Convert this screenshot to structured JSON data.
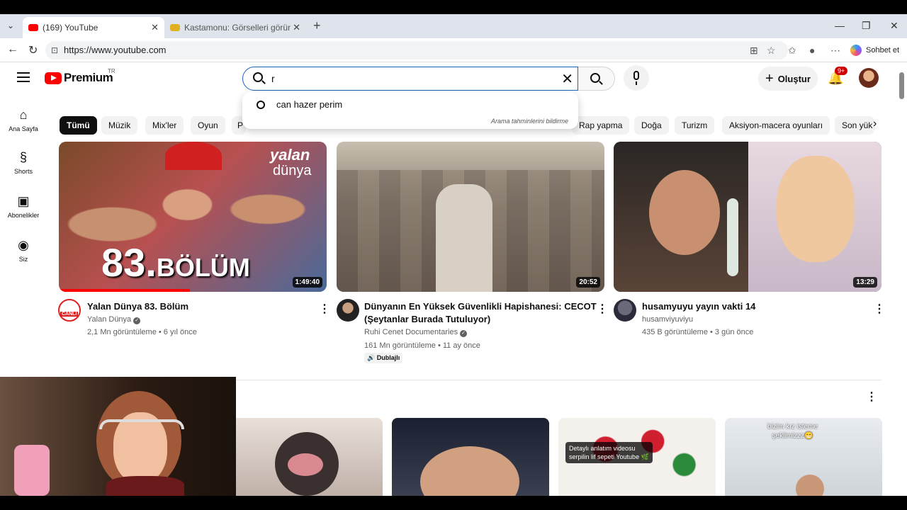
{
  "browser": {
    "tabs": [
      {
        "label": "(169) YouTube",
        "active": true
      },
      {
        "label": "Kastamonu: Görselleri görüntüley",
        "active": false
      }
    ],
    "url": "https://www.youtube.com",
    "copilot_label": "Sohbet et"
  },
  "yt": {
    "logo_text": "Premium",
    "country": "TR",
    "search_value": "r",
    "suggestion": "can hazer perim",
    "report_text": "Arama tahminlerini bildirme",
    "create_label": "Oluştur",
    "notif_count": "9+",
    "sidebar": [
      {
        "label": "Ana Sayfa",
        "icon": "home-icon"
      },
      {
        "label": "Shorts",
        "icon": "shorts-icon"
      },
      {
        "label": "Abonelikler",
        "icon": "subscriptions-icon"
      },
      {
        "label": "Siz",
        "icon": "you-icon"
      }
    ],
    "chips": [
      "Tümü",
      "Müzik",
      "Mix'ler",
      "Oyun",
      "P",
      "Rap yapma",
      "Doğa",
      "Turizm",
      "Aksiyon-macera oyunları",
      "Son yük"
    ],
    "videos": [
      {
        "title": "Yalan Dünya 83. Bölüm",
        "channel": "Yalan Dünya",
        "stats": "2,1 Mn görüntüleme • 6 yıl önce",
        "duration": "1:49:40",
        "thumb_text_top": "yalan",
        "thumb_text_mid": "dünya",
        "thumb_text_big": "83.",
        "thumb_text_big2": "BÖLÜM",
        "avatar_text": "CANLI"
      },
      {
        "title_line1": "Dünyanın En Yüksek Güvenlikli Hapishanesi: CECOT",
        "title_line2": "(Şeytanlar Burada Tutuluyor)",
        "channel": "Ruhi Cenet Documentaries",
        "stats": "161 Mn görüntüleme • 11 ay önce",
        "duration": "20:52",
        "badge": "Dublajlı"
      },
      {
        "title": "husamyuyu yayın vakti 14",
        "channel": "husamviyuviyu",
        "stats": "435 B görüntüleme • 3 gün önce",
        "duration": "13:29"
      }
    ],
    "shorts": [
      {
        "caption": ""
      },
      {
        "caption": ""
      },
      {
        "caption_line1": "Detaylı anlatım videosu",
        "caption_line2": "serpilin lif sepeti Youtube 🌿"
      },
      {
        "caption_line1": "bizim kız isteme",
        "caption_line2": "şeklimizzz😁"
      }
    ]
  }
}
